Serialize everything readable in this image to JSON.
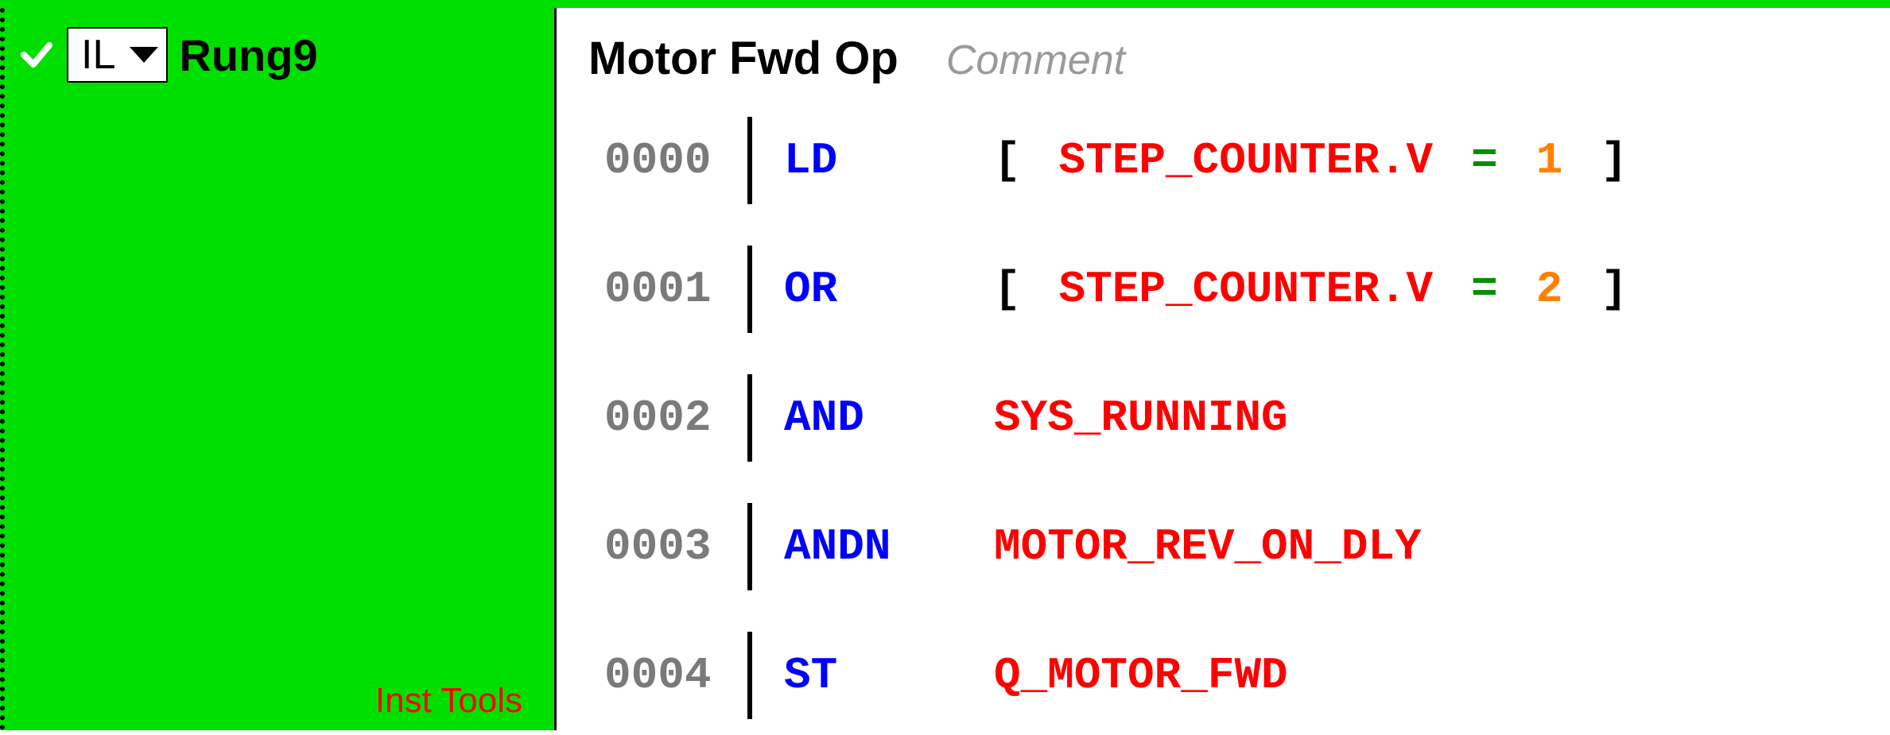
{
  "left": {
    "language": "IL",
    "rung_label": "Rung9",
    "watermark": "Inst Tools"
  },
  "header": {
    "title": "Motor Fwd Op",
    "comment_placeholder": "Comment"
  },
  "code": {
    "lines": [
      {
        "num": "0000",
        "opcode": "LD",
        "operand_tokens": [
          {
            "cls": "tk-bracket",
            "text": "["
          },
          {
            "cls": "tk-sym",
            "text": "STEP_COUNTER.V"
          },
          {
            "cls": "tk-eq",
            "text": "="
          },
          {
            "cls": "tk-num",
            "text": "1"
          },
          {
            "cls": "tk-bracket",
            "text": "]"
          }
        ]
      },
      {
        "num": "0001",
        "opcode": "OR",
        "operand_tokens": [
          {
            "cls": "tk-bracket",
            "text": "["
          },
          {
            "cls": "tk-sym",
            "text": "STEP_COUNTER.V"
          },
          {
            "cls": "tk-eq",
            "text": "="
          },
          {
            "cls": "tk-num",
            "text": "2"
          },
          {
            "cls": "tk-bracket",
            "text": "]"
          }
        ]
      },
      {
        "num": "0002",
        "opcode": "AND",
        "operand_tokens": [
          {
            "cls": "tk-sym",
            "text": "SYS_RUNNING"
          }
        ]
      },
      {
        "num": "0003",
        "opcode": "ANDN",
        "operand_tokens": [
          {
            "cls": "tk-sym",
            "text": "MOTOR_REV_ON_DLY"
          }
        ]
      },
      {
        "num": "0004",
        "opcode": "ST",
        "operand_tokens": [
          {
            "cls": "tk-sym",
            "text": "Q_MOTOR_FWD"
          }
        ]
      }
    ]
  }
}
